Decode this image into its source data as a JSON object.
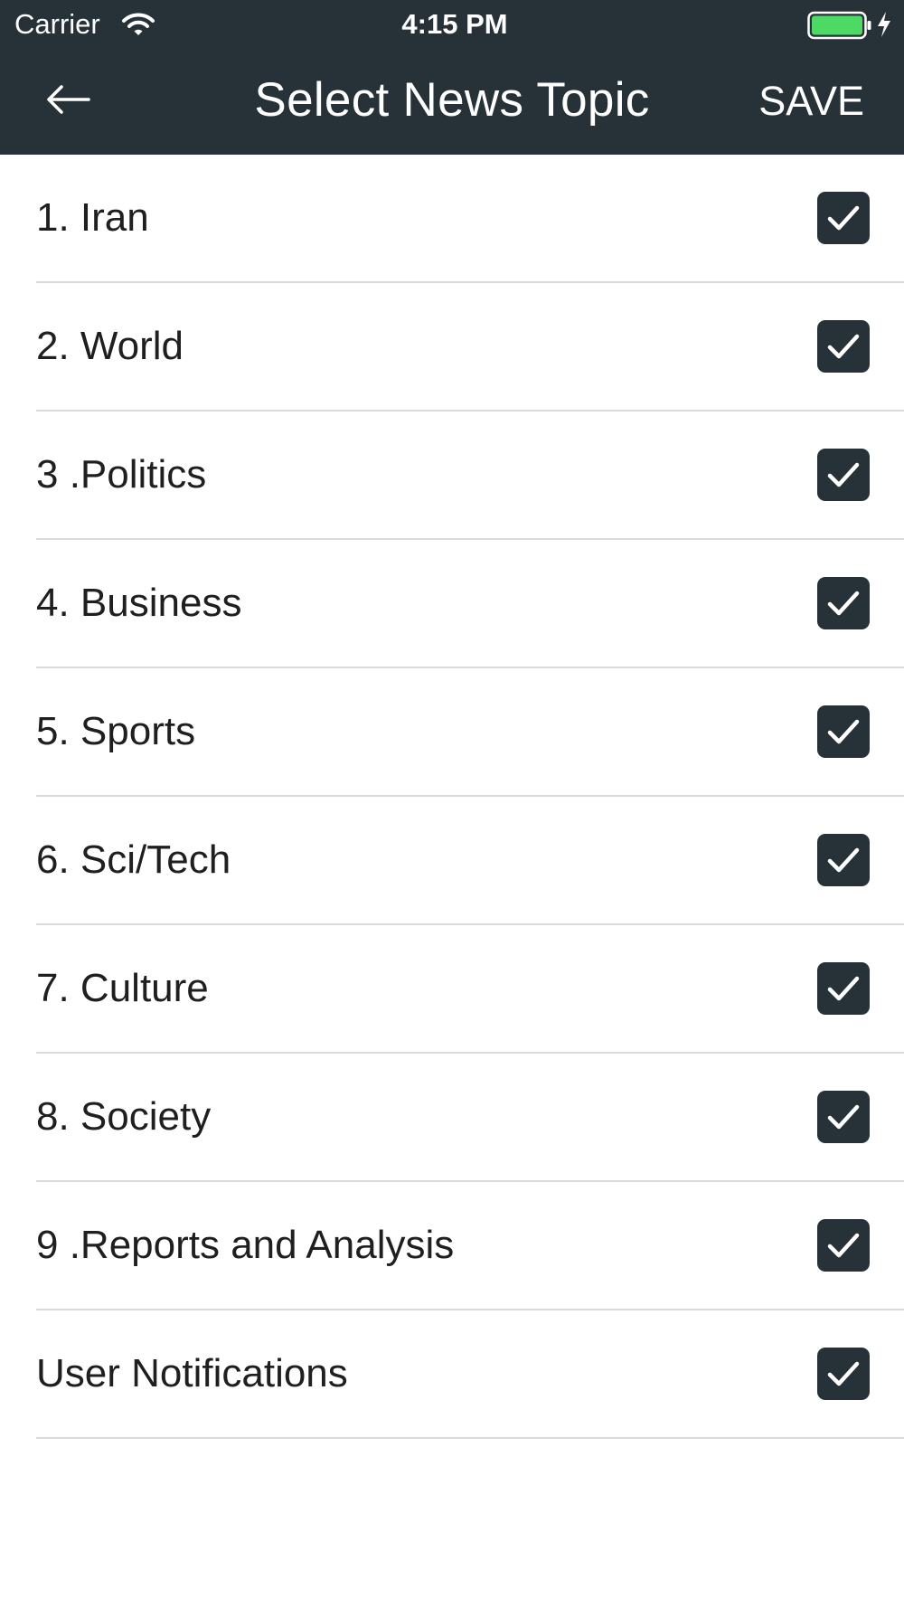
{
  "status_bar": {
    "carrier": "Carrier",
    "time": "4:15 PM",
    "icons": [
      "wifi-icon",
      "battery-icon",
      "charging-bolt-icon"
    ],
    "battery_color": "#4cd964"
  },
  "header": {
    "back_icon": "arrow-left-icon",
    "title": "Select News Topic",
    "save_label": "SAVE",
    "background_color": "#263238"
  },
  "topics": [
    {
      "label": "1. Iran",
      "checked": true
    },
    {
      "label": "2. World",
      "checked": true
    },
    {
      "label": "3 .Politics",
      "checked": true
    },
    {
      "label": "4. Business",
      "checked": true
    },
    {
      "label": "5. Sports",
      "checked": true
    },
    {
      "label": "6. Sci/Tech",
      "checked": true
    },
    {
      "label": "7. Culture",
      "checked": true
    },
    {
      "label": "8. Society",
      "checked": true
    },
    {
      "label": "9 .Reports and Analysis",
      "checked": true
    },
    {
      "label": "User Notifications",
      "checked": true
    }
  ],
  "checkbox_color": "#263238"
}
